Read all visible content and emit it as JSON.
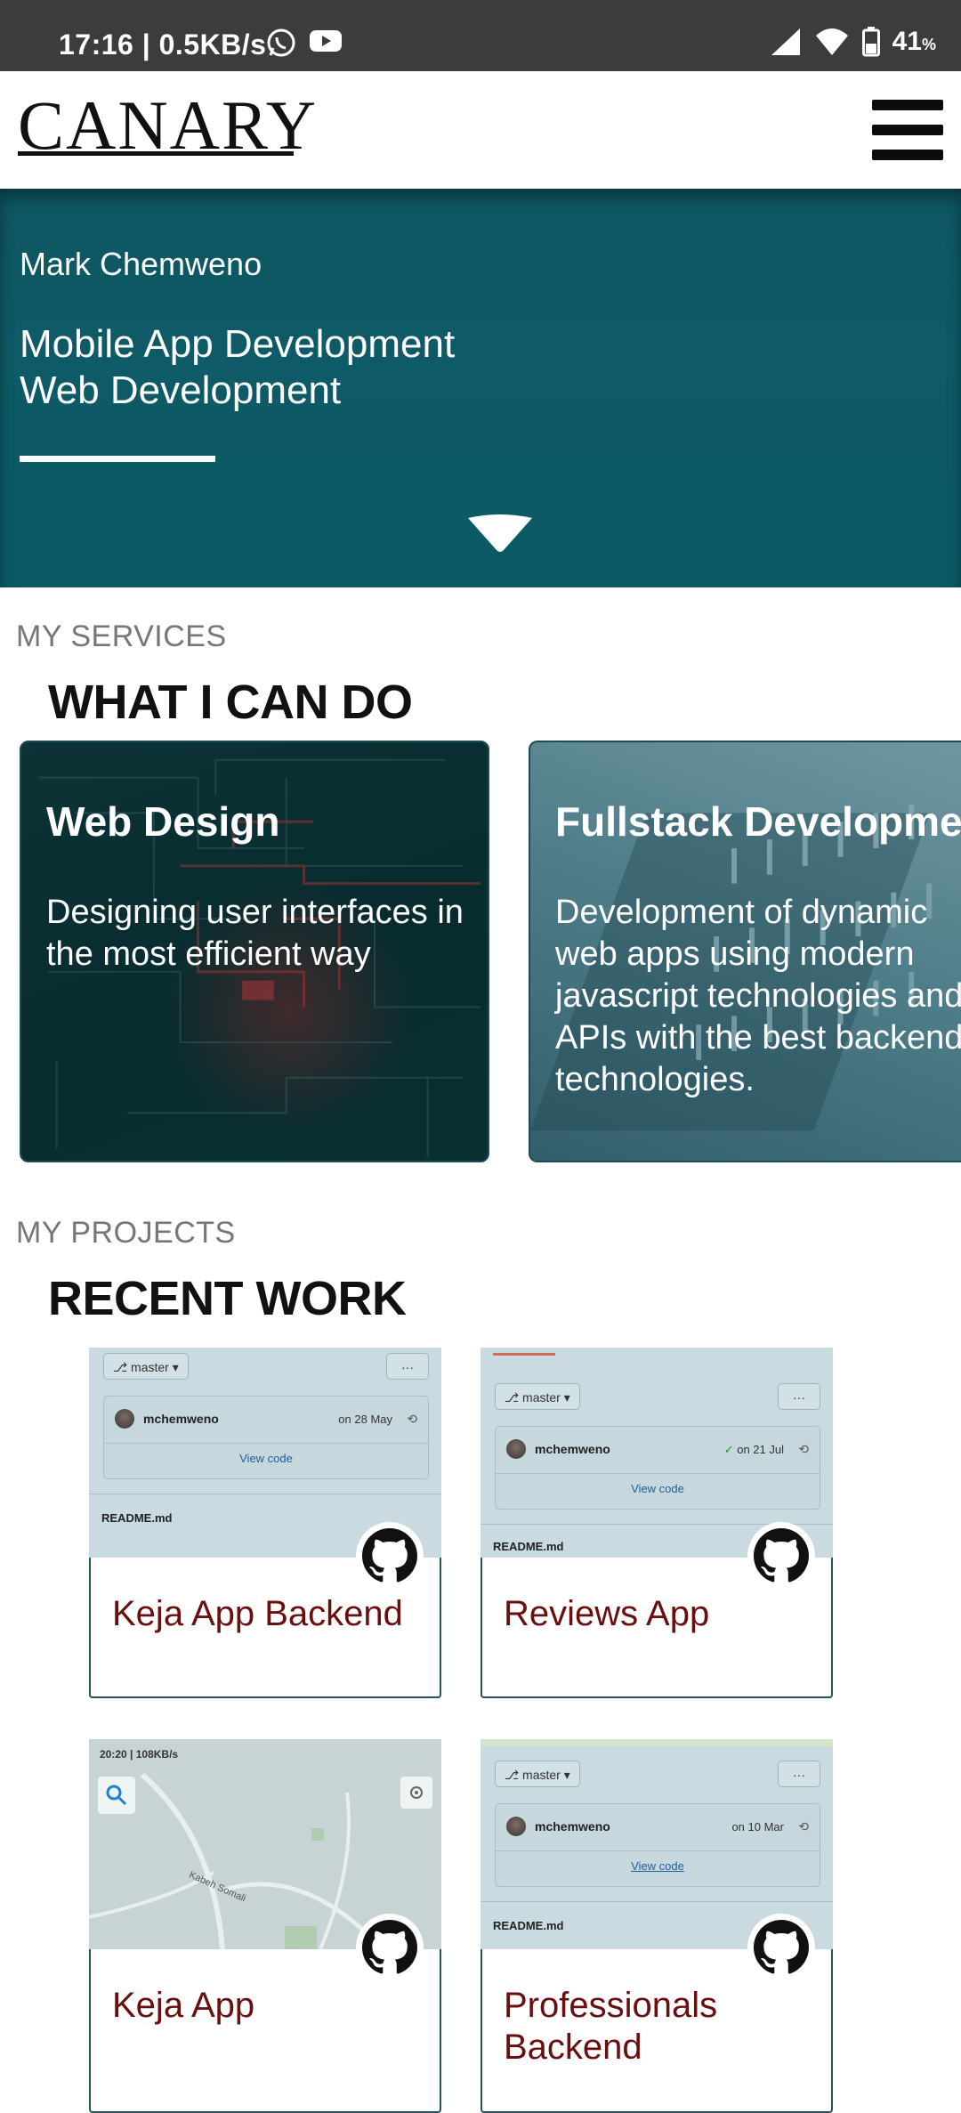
{
  "status_bar": {
    "time_speed": "17:16 | 0.5KB/s",
    "battery": "41",
    "battery_unit": "%"
  },
  "header": {
    "logo": "CANARY"
  },
  "hero": {
    "name": "Mark Chemweno",
    "role_1": "Mobile App Development",
    "role_2": "Web Development"
  },
  "services": {
    "eyebrow": "MY SERVICES",
    "title": "WHAT I CAN DO",
    "cards": [
      {
        "title": "Web Design",
        "text": "Designing user interfaces in the most efficient way"
      },
      {
        "title": "Fullstack Development",
        "text": "Development of dynamic web apps using modern javascript technologies and APIs with the best backend technologies."
      }
    ]
  },
  "projects": {
    "eyebrow": "MY PROJECTS",
    "title": "RECENT WORK",
    "items": [
      {
        "title": "Keja App Backend",
        "branch": "master",
        "user": "mchemweno",
        "date": "on 28 May",
        "view": "View code",
        "readme": "README.md"
      },
      {
        "title": "Reviews App",
        "branch": "master",
        "user": "mchemweno",
        "date": "on 21 Jul",
        "view": "View code",
        "readme": "README.md"
      },
      {
        "title": "Keja App",
        "map_status": "20:20 | 108KB/s",
        "map_label": "Kabeh Somali"
      },
      {
        "title": "Professionals Backend",
        "branch": "master",
        "user": "mchemweno",
        "date": "on 10 Mar",
        "view": "View code",
        "readme": "README.md"
      }
    ]
  }
}
